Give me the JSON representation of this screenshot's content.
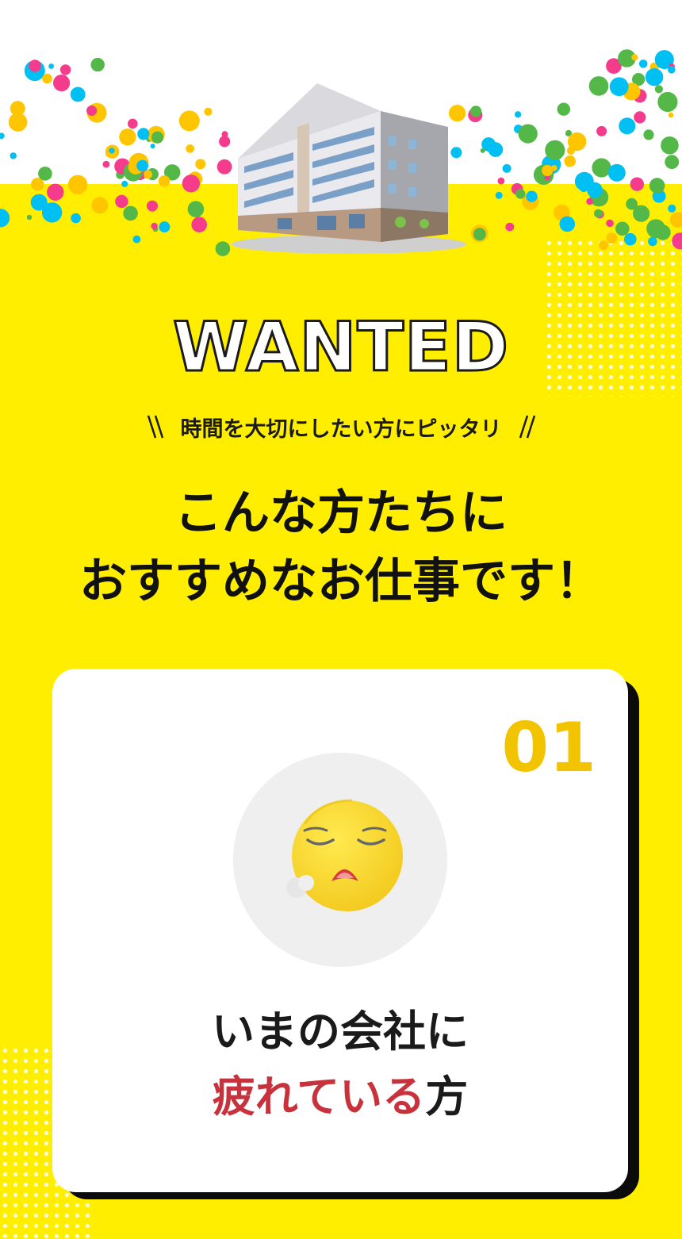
{
  "header": {
    "title": "WANTED",
    "tagline": "時間を大切にしたい方にピッタリ"
  },
  "headline": {
    "line1": "こんな方たちに",
    "line2": "おすすめなお仕事です！"
  },
  "card": {
    "number": "01",
    "line1": "いまの会社に",
    "line2_highlight": "疲れている",
    "line2_suffix": "方",
    "icon": "tired-face-icon"
  },
  "colors": {
    "background": "#FFEE00",
    "number": "#F2C400",
    "highlight": "#C8323C",
    "text": "#1a1a1a",
    "confetti": [
      "#00BFF3",
      "#F53C8C",
      "#FFC600",
      "#54B848"
    ]
  }
}
